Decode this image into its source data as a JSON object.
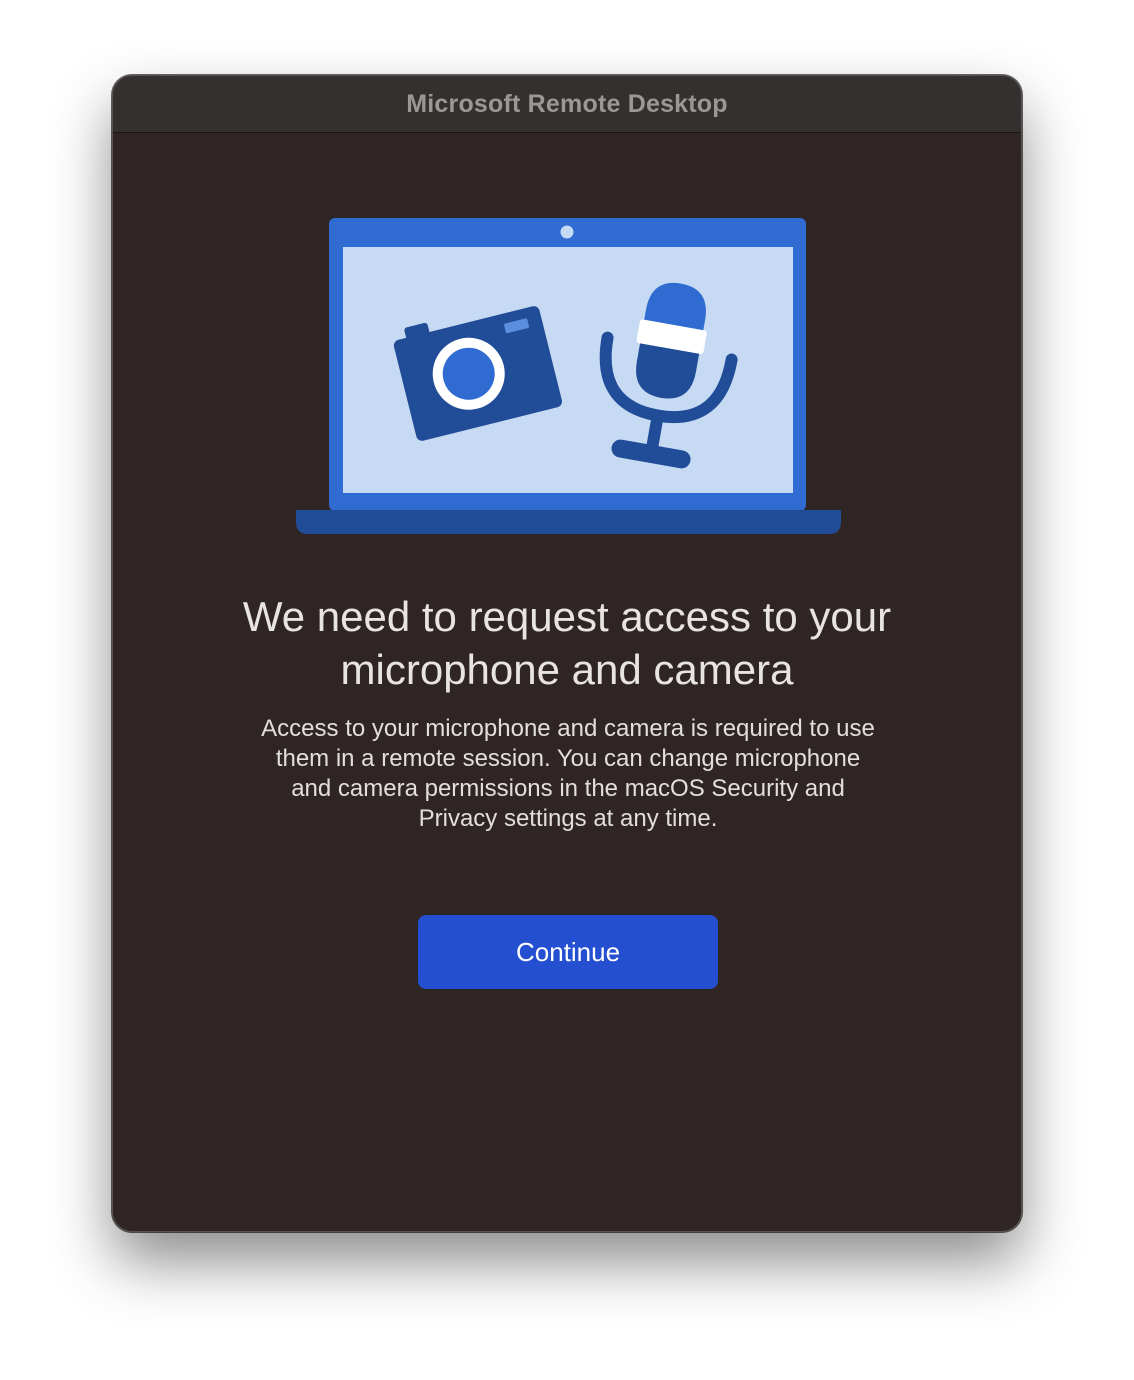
{
  "window": {
    "title": "Microsoft Remote Desktop"
  },
  "illustration": {
    "laptop_icon": "laptop-icon",
    "camera_icon": "camera-icon",
    "microphone_icon": "microphone-icon",
    "colors": {
      "frame": "#2f6bd1",
      "screen": "#c6daf4",
      "dark_blue": "#214c97",
      "bright_blue": "#2f6bd1"
    }
  },
  "content": {
    "heading_line1": "We need to request access to your",
    "heading_line2": "microphone and camera",
    "body_line1": "Access to your microphone and camera is required to use",
    "body_line2": "them in a remote session. You can change microphone",
    "body_line3": "and camera permissions in the macOS Security and",
    "body_line4": "Privacy settings at any time."
  },
  "actions": {
    "continue_label": "Continue",
    "accent_color": "#244fd0"
  }
}
